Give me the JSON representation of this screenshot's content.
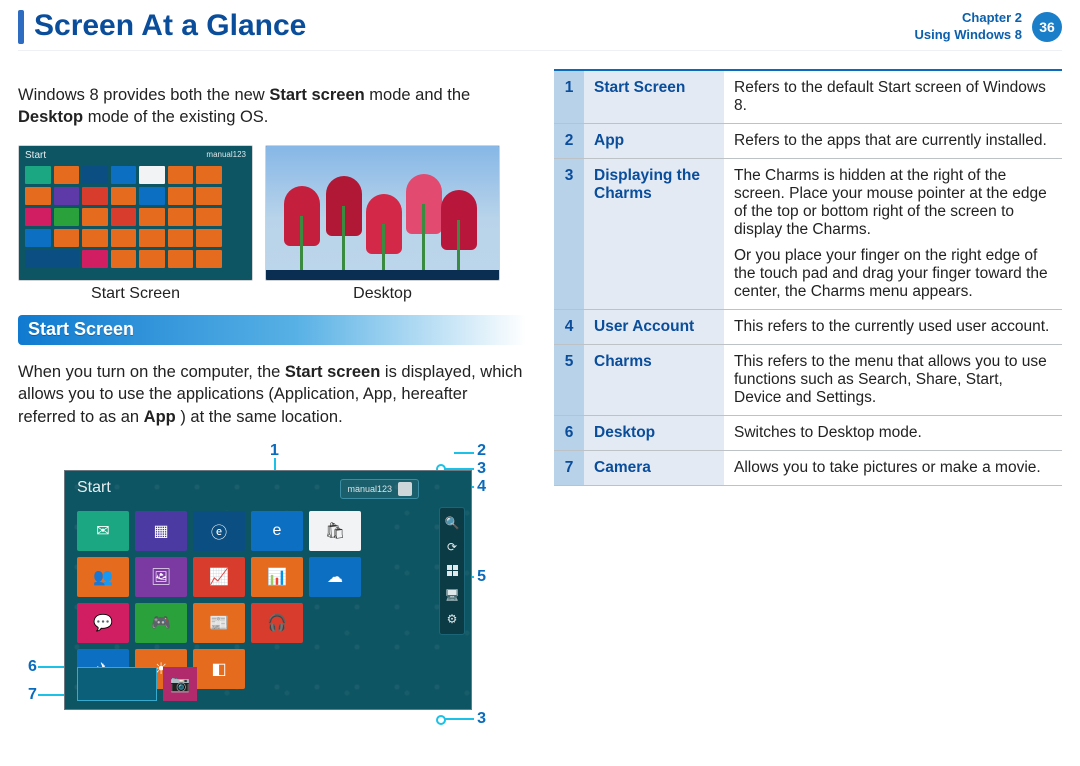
{
  "header": {
    "title": "Screen At a Glance",
    "chapter_line1": "Chapter 2",
    "chapter_line2": "Using Windows 8",
    "page_number": "36"
  },
  "left": {
    "intro_before_bold1": "Windows 8 provides both the new ",
    "intro_bold1": "Start screen",
    "intro_mid": " mode and the ",
    "intro_bold2": "Desktop",
    "intro_after_bold2": " mode of the existing OS.",
    "thumb_labels": {
      "start": "Start Screen",
      "desktop": "Desktop"
    },
    "section_title": "Start Screen",
    "p2_a": "When you turn on the computer, the ",
    "p2_b1": "Start screen",
    "p2_b": " is displayed, which allows you to use the applications (Application, App, hereafter referred to as an ",
    "p2_b2": "App",
    "p2_c": ") at the same location.",
    "mini_start_title": "Start",
    "big_start_title": "Start",
    "user_label": "manual123",
    "callouts": {
      "n1": "1",
      "n2": "2",
      "n3": "3",
      "n4": "4",
      "n5": "5",
      "n6": "6",
      "n7": "7",
      "n3b": "3"
    },
    "icons": {
      "mail": "mail-icon",
      "calendar": "calendar-icon",
      "ie": "ie-icon",
      "bag": "store-icon",
      "people": "people-icon",
      "photos": "photos-icon",
      "finance": "finance-icon",
      "cloud": "skydrive-icon",
      "message": "messaging-icon",
      "game": "games-icon",
      "news": "news-icon",
      "music": "music-icon",
      "travel": "travel-icon",
      "weather": "weather-icon",
      "camera": "camera-icon",
      "search": "search-icon",
      "share": "share-icon",
      "start": "start-icon",
      "devices": "devices-icon",
      "settings": "settings-icon"
    }
  },
  "table": {
    "rows": [
      {
        "num": "1",
        "name": "Start Screen",
        "desc": "Refers to the default Start screen of Windows 8."
      },
      {
        "num": "2",
        "name": "App",
        "desc": "Refers to the apps that are currently installed."
      },
      {
        "num": "3",
        "name": "Displaying the Charms",
        "desc": "The Charms is hidden at the right of the screen. Place your mouse pointer at the edge of the top or bottom right of the screen to display the Charms.\nOr you place your finger on the right edge of the touch pad and drag your finger toward the center, the Charms menu appears."
      },
      {
        "num": "4",
        "name": "User Account",
        "desc": "This refers to the currently used user account."
      },
      {
        "num": "5",
        "name": "Charms",
        "desc": "This refers to the menu that allows you to use functions such as Search, Share, Start, Device and Settings."
      },
      {
        "num": "6",
        "name": "Desktop",
        "desc": "Switches to Desktop mode."
      },
      {
        "num": "7",
        "name": "Camera",
        "desc": "Allows you to take pictures or make a movie."
      }
    ]
  }
}
